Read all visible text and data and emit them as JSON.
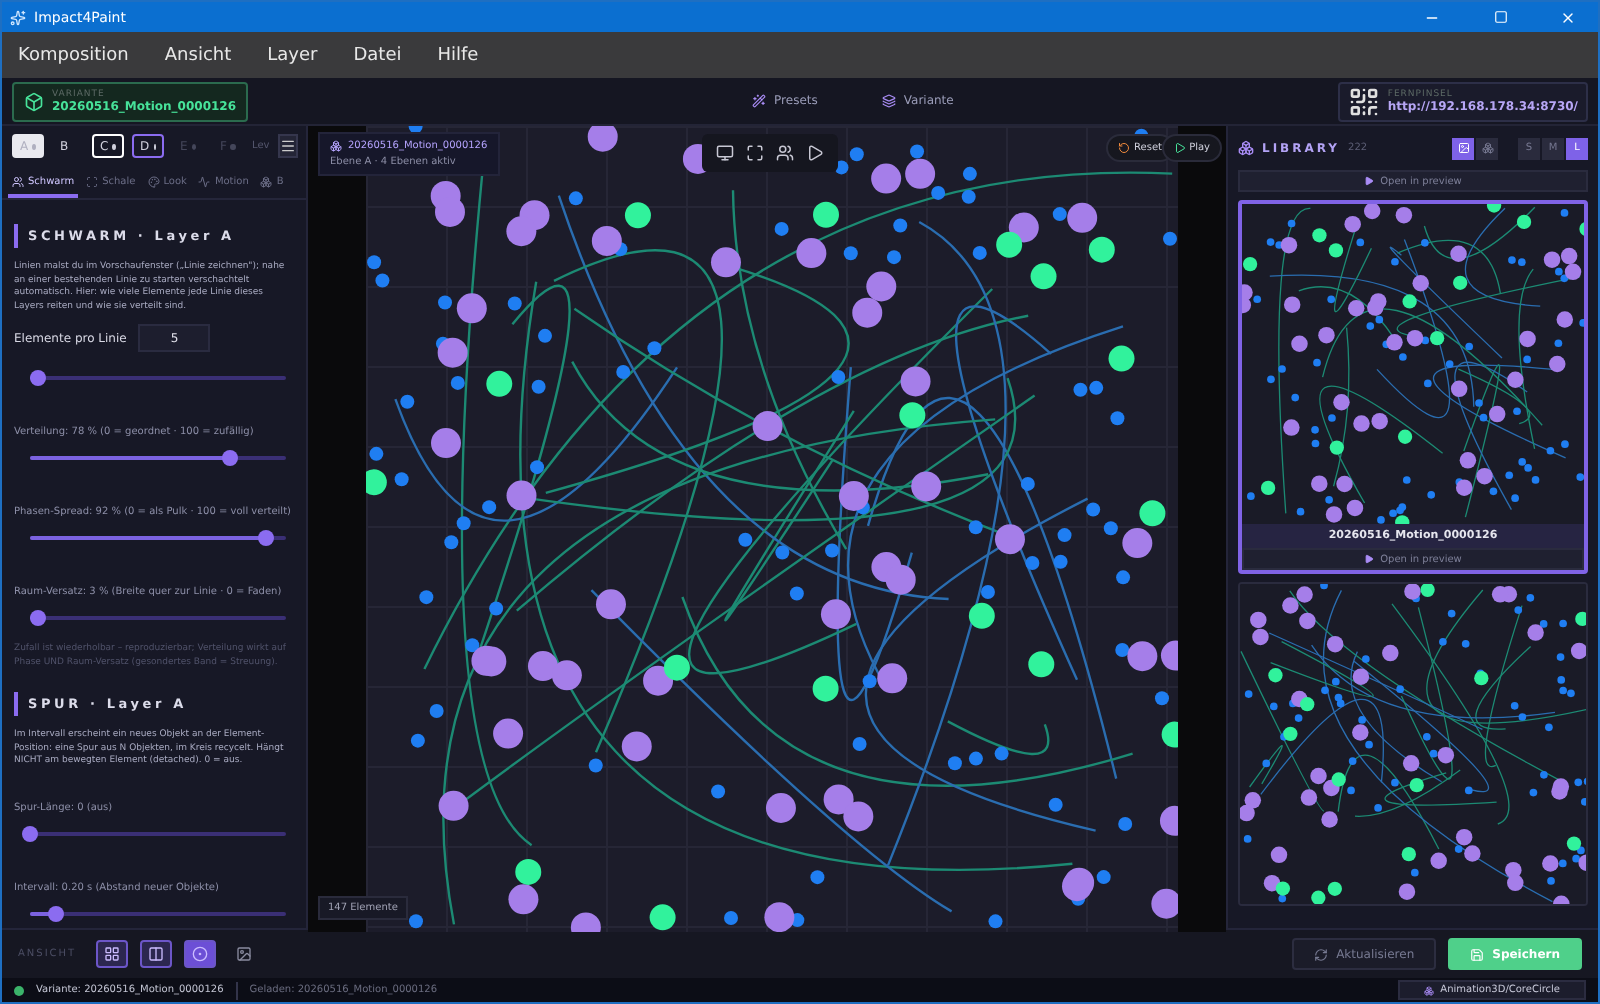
{
  "window": {
    "title": "Impact4Paint"
  },
  "menu": [
    "Komposition",
    "Ansicht",
    "Layer",
    "Datei",
    "Hilfe"
  ],
  "header": {
    "variant_label": "VARIANTE",
    "variant_name": "20260516_Motion_0000126",
    "center_buttons": [
      {
        "kind": "presets",
        "label": "Presets"
      },
      {
        "kind": "variant",
        "label": "Variante"
      }
    ],
    "remote_label": "FERNPINSEL",
    "remote_url": "http://192.168.178.34:8730/"
  },
  "layers": [
    {
      "label": "A",
      "dot": true,
      "selected": true,
      "disabled": false
    },
    {
      "label": "B",
      "dot": false,
      "selected": false,
      "disabled": false
    },
    {
      "label": "C",
      "dot": true,
      "selected": false,
      "disabled": false,
      "color": "#ffffff"
    },
    {
      "label": "D",
      "dot": true,
      "selected": false,
      "disabled": false,
      "color": "#8b6cf0"
    },
    {
      "label": "E",
      "dot": true,
      "selected": false,
      "disabled": true
    },
    {
      "label": "F",
      "dot": true,
      "selected": false,
      "disabled": true
    }
  ],
  "layer_menu_label": "Lev",
  "tabs": [
    {
      "label": "Schwarm",
      "selected": true
    },
    {
      "label": "Schale",
      "selected": false
    },
    {
      "label": "Look",
      "selected": false
    },
    {
      "label": "Motion",
      "selected": false
    },
    {
      "label": "B",
      "selected": false
    }
  ],
  "sections": [
    {
      "title": "SCHWARM · Layer A",
      "controls": [
        {
          "kind": "text",
          "text": "Linien malst du im Vorschaufenster („Linie zeichnen\"); nahe an einer bestehenden Linie zu starten verschachtelt automatisch. Hier: wie viele Elemente jede Linie dieses Layers reiten und wie sie verteilt sind."
        },
        {
          "kind": "number",
          "label": "Elemente pro Linie",
          "value": "5"
        },
        {
          "kind": "slider",
          "level": 0.03
        },
        {
          "kind": "slider",
          "label": "Verteilung: 78 %  (0 = geordnet · 100 = zufällig)",
          "level": 0.78
        },
        {
          "kind": "slider",
          "label": "Phasen-Spread: 92 %  (0 = als Pulk · 100 = voll verteilt)",
          "level": 0.92
        },
        {
          "kind": "slider",
          "label": "Raum-Versatz: 3 %  (Breite quer zur Linie · 0 = Faden)",
          "level": 0.03
        },
        {
          "kind": "note",
          "text": "Zufall ist wiederholbar – reproduzierbar; Verteilung wirkt auf Phase UND Raum-Versatz (gesondertes Band = Streuung)."
        }
      ]
    },
    {
      "title": "SPUR · Layer A",
      "controls": [
        {
          "kind": "text",
          "text": "Im Intervall erscheint ein neues Objekt an der Element-Position: eine Spur aus N Objekten, im Kreis recycelt. Hängt NICHT am bewegten Element (detached). 0 = aus."
        },
        {
          "kind": "slider",
          "label": "Spur-Länge: 0  (aus)",
          "level": 0
        },
        {
          "kind": "slider",
          "label": "Intervall: 0.20 s  (Abstand neuer Objekte)",
          "level": 0.1
        }
      ]
    }
  ],
  "canvas": {
    "info_title": "20260516_Motion_0000126",
    "info_subtitle": "Ebene A · 4 Ebenen aktiv",
    "buttons": [
      {
        "kind": "reset",
        "label": "Reset"
      },
      {
        "kind": "play",
        "label": "Play"
      }
    ],
    "count": "147 Elemente"
  },
  "library": {
    "title": "LIBRARY",
    "count": "222",
    "views": [
      {
        "kind": "image",
        "selected": true
      },
      {
        "kind": "stack",
        "selected": false
      }
    ],
    "sizes": [
      {
        "label": "S",
        "selected": false
      },
      {
        "label": "M",
        "selected": false
      },
      {
        "label": "L",
        "selected": true
      }
    ],
    "open_button": "Open in preview",
    "cards": [
      {
        "title": "20260516_Motion_0000126",
        "open": "Open in preview",
        "selected": true
      },
      {
        "selected": false
      }
    ]
  },
  "toolbar": {
    "label": "ANSICHT",
    "views": [
      {
        "kind": "grid",
        "selected": false
      },
      {
        "kind": "split",
        "selected": false
      },
      {
        "kind": "focus",
        "selected": true
      },
      {
        "kind": "image",
        "selected": false
      }
    ],
    "buttons": [
      {
        "kind": "secondary",
        "label": "Aktualisieren"
      },
      {
        "kind": "primary",
        "label": "Speichern"
      }
    ]
  },
  "status": {
    "variant": "Variante: 20260516_Motion_0000126",
    "loaded": "Geladen: 20260516_Motion_0000126",
    "path": "Animation3D/CoreCircle"
  }
}
